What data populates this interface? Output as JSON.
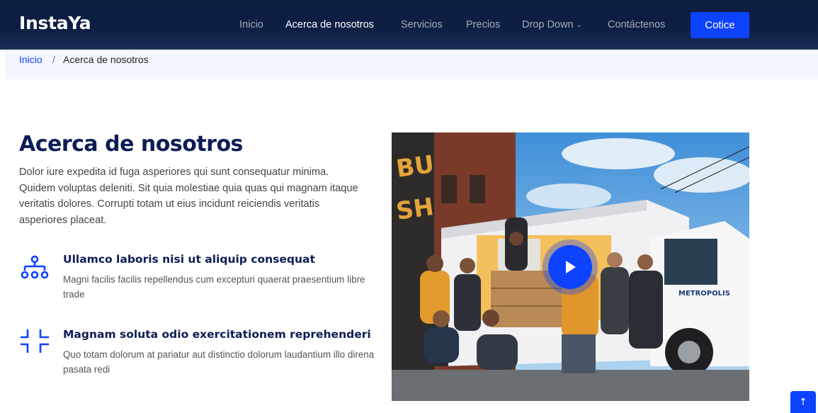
{
  "header": {
    "logo": "InstaYa",
    "nav": [
      {
        "label": "Inicio",
        "active": false
      },
      {
        "label": "Acerca de nosotros",
        "active": true
      },
      {
        "label": "Servicios",
        "active": false
      },
      {
        "label": "Precios",
        "active": false
      },
      {
        "label": "Drop Down",
        "active": false
      },
      {
        "label": "Contáctenos",
        "active": false
      }
    ],
    "cta_label": "Cotice"
  },
  "breadcrumb": {
    "home": "Inicio",
    "separator": "/",
    "current": "Acerca de nosotros"
  },
  "about": {
    "title": "Acerca de nosotros",
    "lead": "Dolor iure expedita id fuga asperiores qui sunt consequatur minima. Quidem voluptas deleniti. Sit quia molestiae quia quas qui magnam itaque veritatis dolores. Corrupti totam ut eius incidunt reiciendis veritatis asperiores placeat.",
    "features": [
      {
        "icon": "diagram-tree-icon",
        "title": "Ullamco laboris nisi ut aliquip consequat",
        "desc": "Magni facilis facilis repellendus cum excepturi quaerat praesentium libre trade"
      },
      {
        "icon": "fullscreen-exit-icon",
        "title": "Magnam soluta odio exercitationem reprehenderi",
        "desc": "Quo totam dolorum at pariatur aut distinctio dolorum laudantium illo direna pasata redi"
      }
    ]
  },
  "media": {
    "truck_logo": "METROPOLIS"
  },
  "colors": {
    "accent": "#0d42ff",
    "navy": "#0e1d56",
    "header_bg": "#0d1d3f",
    "breadcrumb_bg": "#f3f6fc"
  }
}
